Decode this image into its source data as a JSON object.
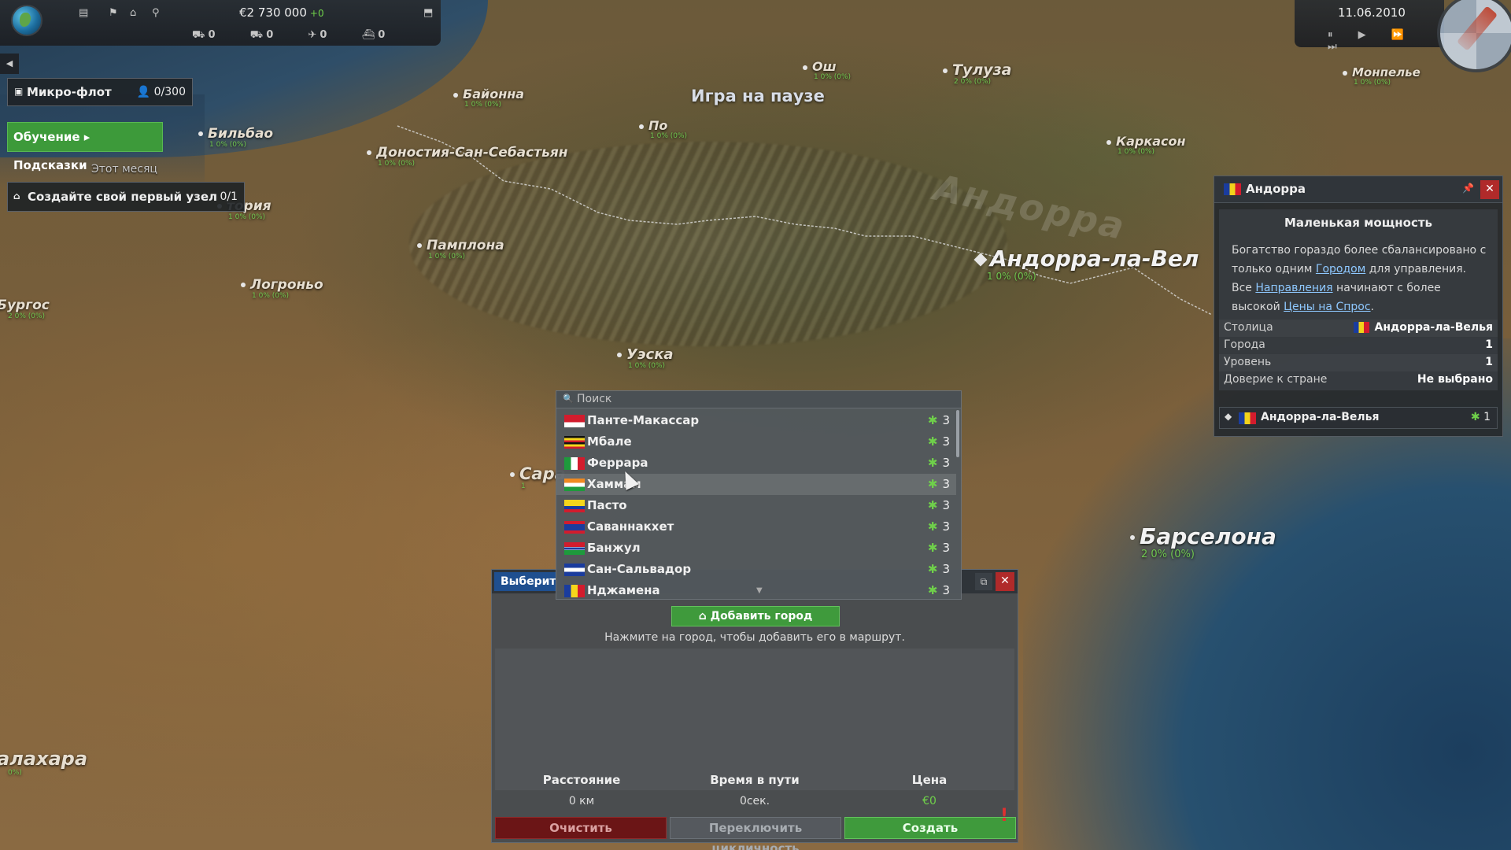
{
  "top_bar": {
    "money": "€2 730 000",
    "money_delta": "+0",
    "counters": [
      "0",
      "0",
      "0",
      "0"
    ]
  },
  "date_bar": {
    "date": "11.06.2010",
    "speed_controls": "⏸ ▶ ⏩ ⏭"
  },
  "map": {
    "paused_label": "Игра на паузе",
    "country_ghost": "Андорра",
    "cities": [
      {
        "name": "Байонна",
        "sub": "1  0% (0%)"
      },
      {
        "name": "Бильбао",
        "sub": "1  0% (0%)"
      },
      {
        "name": "Доностия-Сан-Себастьян",
        "sub": "1  0% (0%)"
      },
      {
        "name": "Ош",
        "sub": "1  0% (0%)"
      },
      {
        "name": "Тулуза",
        "sub": "2  0% (0%)"
      },
      {
        "name": "Монпелье",
        "sub": "1  0% (0%)"
      },
      {
        "name": "По",
        "sub": "1  0% (0%)"
      },
      {
        "name": "Каркасон",
        "sub": "1  0% (0%)"
      },
      {
        "name": "тория",
        "sub": "1  0% (0%)"
      },
      {
        "name": "Памплона",
        "sub": "1  0% (0%)"
      },
      {
        "name": "Логроньо",
        "sub": "1  0% (0%)"
      },
      {
        "name": "Бургос",
        "sub": "2  0% (0%)"
      },
      {
        "name": "Уэска",
        "sub": "1  0% (0%)"
      },
      {
        "name": "Андорра-ла-Вел",
        "sub": "1  0% (0%)"
      },
      {
        "name": "Барселона",
        "sub": "2  0% (0%)"
      },
      {
        "name": "Сара",
        "sub": "1"
      },
      {
        "name": "алахара",
        "sub": "0%)"
      }
    ]
  },
  "left_panel": {
    "microfleet_label": "Микро-флот",
    "microfleet_count": "0/300",
    "tutorial_label": "Обучение ▸ Подсказки",
    "this_month": "Этот месяц",
    "task_label": "Создайте свой первый узел",
    "task_count": "0/1"
  },
  "country_panel": {
    "name": "Андорра",
    "subtitle": "Маленькая мощность",
    "desc_1": "Богатство гораздо более сбалансировано с только одним ",
    "desc_link_1": "Городом",
    "desc_2": " для управления. Все ",
    "desc_link_2": "Направления",
    "desc_3": " начинают с более высокой ",
    "desc_link_3": "Цены на Спрос",
    "desc_4": ".",
    "rows": [
      {
        "key": "Столица",
        "value": "Андорра-ла-Велья"
      },
      {
        "key": "Города",
        "value": "1"
      },
      {
        "key": "Уровень",
        "value": "1"
      },
      {
        "key": "Доверие к стране",
        "value": "Не выбрано"
      }
    ],
    "city_name": "Андорра-ла-Велья",
    "city_level": "1"
  },
  "route_dialog": {
    "title": "Выберит",
    "add_city": "Добавить город",
    "hint": "Нажмите на город, чтобы добавить его в маршрут.",
    "headers": [
      "Расстояние",
      "Время в пути",
      "Цена"
    ],
    "values": [
      "0 км",
      "0сек.",
      "€0"
    ],
    "clear": "Очистить",
    "toggle_cycle": "Переключить цикличность",
    "create": "Создать",
    "warning": "!"
  },
  "city_search": {
    "placeholder": "Поиск",
    "items": [
      {
        "name": "Панте-Макассар",
        "level": "3"
      },
      {
        "name": "Мбале",
        "level": "3"
      },
      {
        "name": "Феррара",
        "level": "3"
      },
      {
        "name": "Хаммам",
        "level": "3"
      },
      {
        "name": "Пасто",
        "level": "3"
      },
      {
        "name": "Саваннакхет",
        "level": "3"
      },
      {
        "name": "Банжул",
        "level": "3"
      },
      {
        "name": "Сан-Сальвадор",
        "level": "3"
      },
      {
        "name": "Нджамена",
        "level": "3"
      }
    ]
  },
  "colors": {
    "accent_green": "#3f9a3c",
    "danger_red": "#b02a2a",
    "title_blue": "#1f4f8f",
    "level_star": "#6fd04a"
  }
}
